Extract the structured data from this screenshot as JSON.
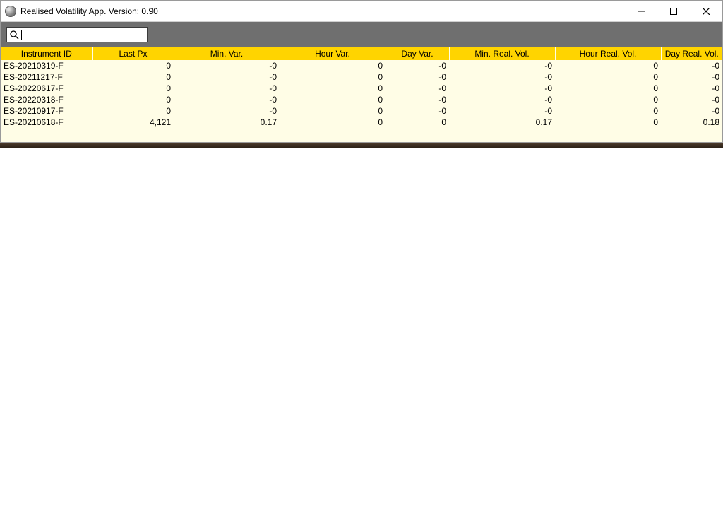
{
  "window": {
    "title": "Realised Volatility App. Version: 0.90"
  },
  "search": {
    "value": "",
    "placeholder": ""
  },
  "table": {
    "headers": {
      "instrument_id": "Instrument ID",
      "last_px": "Last Px",
      "min_var": "Min. Var.",
      "hour_var": "Hour Var.",
      "day_var": "Day Var.",
      "min_real_vol": "Min. Real. Vol.",
      "hour_real_vol": "Hour Real. Vol.",
      "day_real_vol": "Day Real. Vol."
    },
    "rows": [
      {
        "instrument_id": "ES-20210319-F",
        "last_px": "0",
        "min_var": "-0",
        "hour_var": "0",
        "day_var": "-0",
        "min_real_vol": "-0",
        "hour_real_vol": "0",
        "day_real_vol": "-0"
      },
      {
        "instrument_id": "ES-20211217-F",
        "last_px": "0",
        "min_var": "-0",
        "hour_var": "0",
        "day_var": "-0",
        "min_real_vol": "-0",
        "hour_real_vol": "0",
        "day_real_vol": "-0"
      },
      {
        "instrument_id": "ES-20220617-F",
        "last_px": "0",
        "min_var": "-0",
        "hour_var": "0",
        "day_var": "-0",
        "min_real_vol": "-0",
        "hour_real_vol": "0",
        "day_real_vol": "-0"
      },
      {
        "instrument_id": "ES-20220318-F",
        "last_px": "0",
        "min_var": "-0",
        "hour_var": "0",
        "day_var": "-0",
        "min_real_vol": "-0",
        "hour_real_vol": "0",
        "day_real_vol": "-0"
      },
      {
        "instrument_id": "ES-20210917-F",
        "last_px": "0",
        "min_var": "-0",
        "hour_var": "0",
        "day_var": "-0",
        "min_real_vol": "-0",
        "hour_real_vol": "0",
        "day_real_vol": "-0"
      },
      {
        "instrument_id": "ES-20210618-F",
        "last_px": "4,121",
        "min_var": "0.17",
        "hour_var": "0",
        "day_var": "0",
        "min_real_vol": "0.17",
        "hour_real_vol": "0",
        "day_real_vol": "0.18"
      }
    ]
  }
}
